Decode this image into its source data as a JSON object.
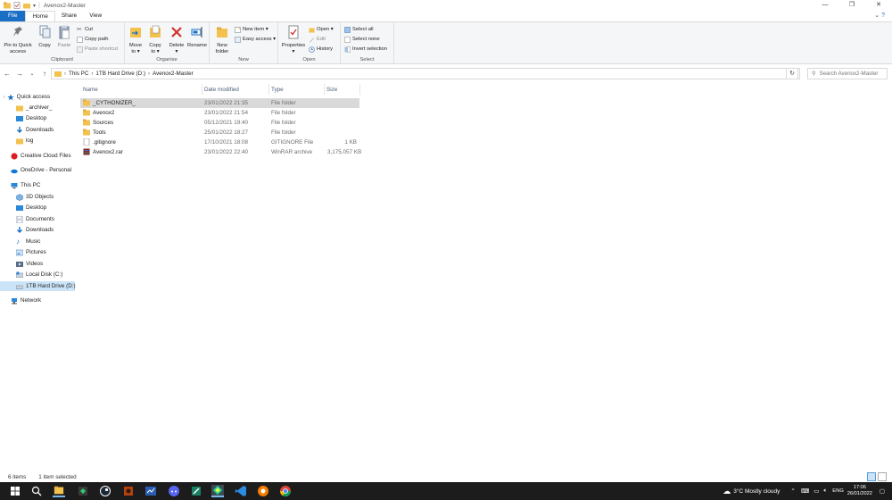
{
  "window": {
    "title": "Avenox2-Master",
    "controls": [
      "—",
      "❐",
      "✕"
    ]
  },
  "ribbon_tabs": [
    {
      "label": "File"
    },
    {
      "label": "Home"
    },
    {
      "label": "Share"
    },
    {
      "label": "View"
    }
  ],
  "ribbon": {
    "clipboard": {
      "label": "Clipboard",
      "pin": "Pin to Quick access",
      "pin_l1": "Pin to Quick",
      "pin_l2": "access",
      "copy": "Copy",
      "paste": "Paste",
      "cut": "Cut",
      "copy_path": "Copy path",
      "paste_shortcut": "Paste shortcut"
    },
    "organise": {
      "label": "Organise",
      "move_to_l1": "Move",
      "move_to_l2": "to ▾",
      "copy_to_l1": "Copy",
      "copy_to_l2": "to ▾",
      "delete": "Delete",
      "rename": "Rename"
    },
    "new": {
      "label": "New",
      "new_folder_l1": "New",
      "new_folder_l2": "folder",
      "new_item": "New item ▾",
      "easy_access": "Easy access ▾"
    },
    "open": {
      "label": "Open",
      "properties": "Properties",
      "open": "Open ▾",
      "edit": "Edit",
      "history": "History"
    },
    "select": {
      "label": "Select",
      "select_all": "Select all",
      "select_none": "Select none",
      "invert": "Invert selection"
    }
  },
  "address": {
    "crumbs": [
      "This PC",
      "1TB Hard Drive (D:)",
      "Avenox2-Master"
    ],
    "search_placeholder": "Search Avenox2-Master"
  },
  "nav": {
    "quick_access": "Quick access",
    "quick_items": [
      "_archiver_",
      "Desktop",
      "Downloads",
      "log"
    ],
    "creative_cloud": "Creative Cloud Files",
    "onedrive": "OneDrive - Personal",
    "this_pc": "This PC",
    "pc_items": [
      "3D Objects",
      "Desktop",
      "Documents",
      "Downloads",
      "Music",
      "Pictures",
      "Videos",
      "Local Disk (C:)",
      "1TB Hard Drive (D:)"
    ],
    "network": "Network"
  },
  "columns": {
    "name": "Name",
    "date": "Date modified",
    "type": "Type",
    "size": "Size"
  },
  "files": [
    {
      "name": "_CYTHONIZER_",
      "date": "23/01/2022 21:35",
      "type": "File folder",
      "size": "",
      "kind": "folder"
    },
    {
      "name": "Avenox2",
      "date": "23/01/2022 21:54",
      "type": "File folder",
      "size": "",
      "kind": "folder"
    },
    {
      "name": "Sources",
      "date": "05/12/2021 19:40",
      "type": "File folder",
      "size": "",
      "kind": "folder"
    },
    {
      "name": "Tools",
      "date": "25/01/2022 18:27",
      "type": "File folder",
      "size": "",
      "kind": "folder"
    },
    {
      "name": ".gitignore",
      "date": "17/10/2021 18:08",
      "type": "GITIGNORE File",
      "size": "1 KB",
      "kind": "file"
    },
    {
      "name": "Avenox2.rar",
      "date": "23/01/2022 22:40",
      "type": "WinRAR archive",
      "size": "3,175,057 KB",
      "kind": "rar"
    }
  ],
  "status": {
    "count": "6 items",
    "selected": "1 item selected"
  },
  "taskbar": {
    "weather": "3°C  Mostly cloudy",
    "lang": "ENG",
    "time": "17:06",
    "date": "26/01/2022"
  },
  "colors": {
    "accent": "#1a6fc4",
    "folder": "#f2c14e",
    "selection": "#cce4f7",
    "taskbar": "#1c1c1c"
  }
}
